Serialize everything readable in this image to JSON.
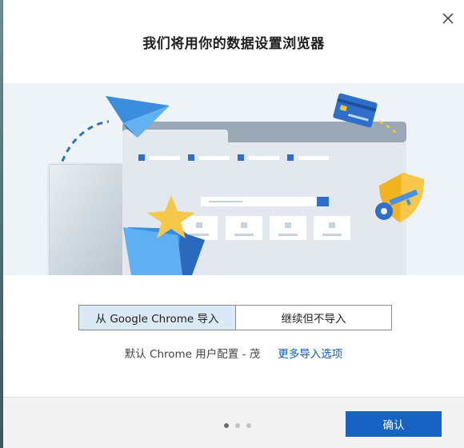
{
  "dialog": {
    "title": "我们将用你的数据设置浏览器",
    "close_icon": "close-icon"
  },
  "hero": {
    "illustration": "browser-import-illustration",
    "icons": [
      "paper-plane-icon",
      "credit-card-icon",
      "shield-icon",
      "key-icon",
      "star-icon",
      "folder-icon"
    ]
  },
  "import_options": {
    "import_label": "从 Google Chrome 导入",
    "skip_label": "继续但不导入",
    "selected": "import"
  },
  "profile": {
    "text": "默认 Chrome 用户配置 - 茂",
    "more_link": "更多导入选项"
  },
  "footer": {
    "page_total": 3,
    "page_current": 1,
    "confirm_label": "确认"
  },
  "colors": {
    "accent": "#1763c4",
    "selected_bg": "#dbe9f7",
    "link": "#0f5dbe",
    "hero_bg": "#eef3f7"
  }
}
